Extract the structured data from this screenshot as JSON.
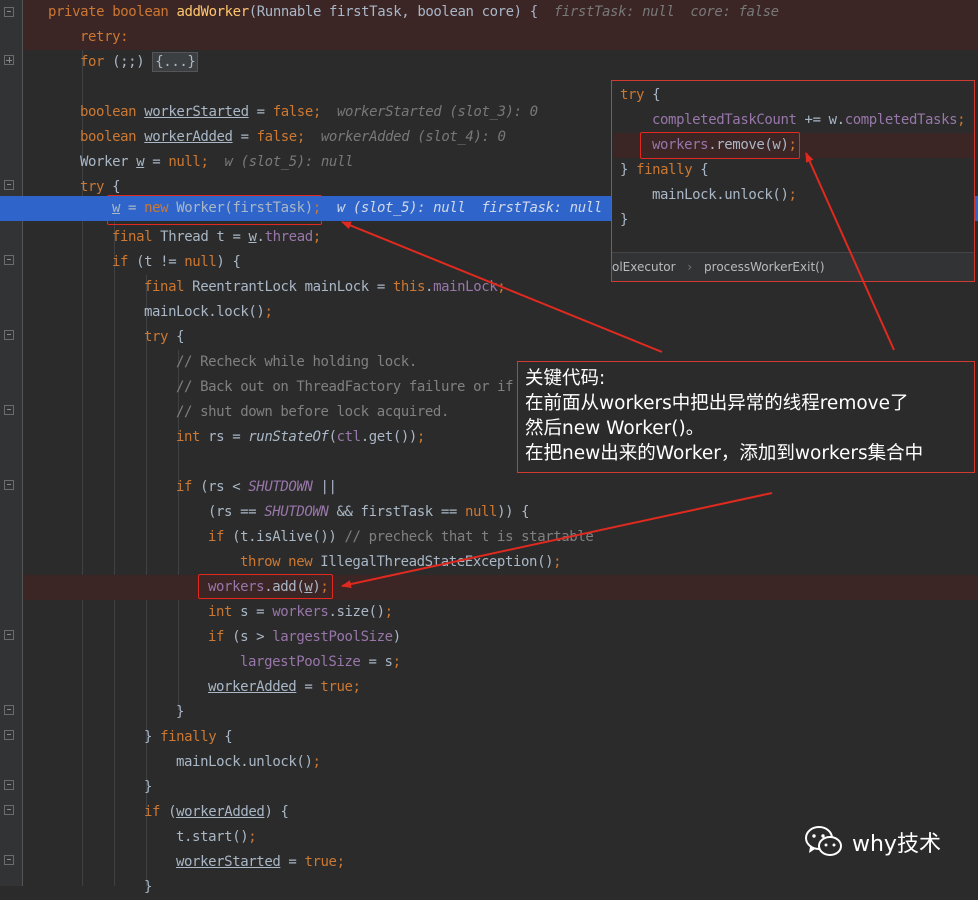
{
  "editor": {
    "lines": [
      [
        "private boolean ",
        "addWorker",
        "(Runnable firstTask, boolean core) {",
        "  firstTask: null  core: false"
      ],
      [
        "retry:"
      ],
      [
        "for",
        " (;;) ",
        "{...}"
      ],
      [
        ""
      ],
      [
        "boolean ",
        "workerStarted",
        " = ",
        "false",
        ";",
        "  workerStarted (slot_3): 0"
      ],
      [
        "boolean ",
        "workerAdded",
        " = ",
        "false",
        ";",
        "  workerAdded (slot_4): 0"
      ],
      [
        "Worker ",
        "w",
        " = ",
        "null",
        ";",
        "  w (slot_5): null"
      ],
      [
        "try",
        " {"
      ],
      [
        "w",
        " = ",
        "new",
        " Worker(firstTask)",
        ";",
        "  w (slot_5): null  firstTask: null"
      ],
      [
        "final",
        " Thread t = ",
        "w",
        ".",
        "thread",
        ";"
      ],
      [
        "if",
        " (t != ",
        "null",
        ") {"
      ],
      [
        "final",
        " ReentrantLock mainLock = ",
        "this",
        ".",
        "mainLock",
        ";"
      ],
      [
        "mainLock.lock()",
        ";"
      ],
      [
        "try",
        " {"
      ],
      [
        "// Recheck while holding lock."
      ],
      [
        "// Back out on ThreadFactory failure or if"
      ],
      [
        "// shut down before lock acquired."
      ],
      [
        "int",
        " rs = ",
        "runStateOf",
        "(",
        "ctl",
        ".get())",
        ";"
      ],
      [
        ""
      ],
      [
        "if",
        " (rs < ",
        "SHUTDOWN",
        " ||"
      ],
      [
        "(rs == ",
        "SHUTDOWN",
        " && firstTask == ",
        "null",
        ")) {"
      ],
      [
        "if",
        " (t.isAlive()) ",
        "// precheck that t is startable"
      ],
      [
        "throw new",
        " IllegalThreadStateException()",
        ";"
      ],
      [
        "workers",
        ".add(",
        "w",
        ")",
        ";"
      ],
      [
        "int",
        " s = ",
        "workers",
        ".size()",
        ";"
      ],
      [
        "if",
        " (s > ",
        "largestPoolSize",
        ")"
      ],
      [
        "largestPoolSize",
        " = s",
        ";"
      ],
      [
        "workerAdded",
        " = ",
        "true",
        ";"
      ],
      [
        "}"
      ],
      [
        "} ",
        "finally",
        " {"
      ],
      [
        "mainLock.unlock()",
        ";"
      ],
      [
        "}"
      ],
      [
        "if",
        " (",
        "workerAdded",
        ") {"
      ],
      [
        "t.start()",
        ";"
      ],
      [
        "workerStarted",
        " = ",
        "true",
        ";"
      ],
      [
        "}"
      ]
    ]
  },
  "popup": {
    "lines": [
      [
        "try",
        " {"
      ],
      [
        "completedTaskCount",
        " += w.",
        "completedTasks",
        ";"
      ],
      [
        "workers",
        ".remove(w)",
        ";"
      ],
      [
        "} ",
        "finally",
        " {"
      ],
      [
        "mainLock.unlock()",
        ";"
      ],
      [
        "}"
      ]
    ],
    "breadcrumb": [
      "olExecutor",
      "›",
      "processWorkerExit()"
    ]
  },
  "callout": {
    "lines": [
      "关键代码:",
      "在前面从workers中把出异常的线程remove了",
      "然后new Worker()。",
      "在把new出来的Worker，添加到workers集合中"
    ]
  },
  "watermark": {
    "text": "why技术",
    "icon": "wechat-icon"
  },
  "colors": {
    "background": "#2b2b2b",
    "keyword": "#cc7832",
    "method": "#ffc66d",
    "field": "#9876aa",
    "comment": "#808080",
    "execution_line": "#2f65ca",
    "breakpoint_line": "#3b2525",
    "annotation_red": "#e02a1f"
  }
}
